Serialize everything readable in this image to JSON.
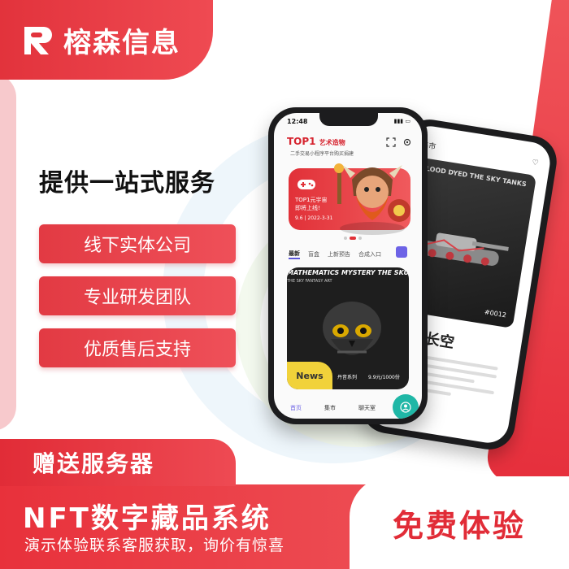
{
  "logo": {
    "text": "榕森信息",
    "icon": "rs-logo-icon"
  },
  "headline": "提供一站式服务",
  "features": [
    "线下实体公司",
    "专业研发团队",
    "优质售后支持"
  ],
  "bonus": "赠送服务器",
  "product": {
    "title": "NFT数字藏品系统",
    "subtitle": "演示体验联系客服获取，询价有惊喜"
  },
  "cta": "免费体验",
  "colors": {
    "brand_red": "#e12c37",
    "accent_purple": "#6d63e6",
    "accent_teal": "#1fb7a6",
    "news_yellow": "#f1d23a"
  },
  "front_phone": {
    "status_time": "12:48",
    "brand": "TOP1",
    "brand_suffix": "艺术造物",
    "subtitle": "二手交易小程序平台购买捐建",
    "banner": {
      "text": "TOP1元宇宙 即将上线!",
      "date": "9.6 | 2022-3-31"
    },
    "tabs": [
      {
        "label": "最新",
        "active": true
      },
      {
        "label": "盲盒",
        "active": false
      },
      {
        "label": "上新预告",
        "active": false
      },
      {
        "label": "合成入口",
        "active": false
      }
    ],
    "nft_card": {
      "title": "MATHEMATICS MYSTERY THE SKULL",
      "subtitle": "THE SKY FANTASY ART",
      "badge": "News",
      "series": "丹音系列",
      "price": "9.9元/1000份"
    },
    "nav": [
      {
        "label": "首页",
        "active": true
      },
      {
        "label": "集市",
        "active": false
      },
      {
        "label": "聊天室",
        "active": false
      }
    ]
  },
  "back_phone": {
    "top_label": "集市",
    "card_title": "BLOOD DYED THE SKY TANKS",
    "card_tag": "#0012",
    "heading": "血染长空"
  }
}
